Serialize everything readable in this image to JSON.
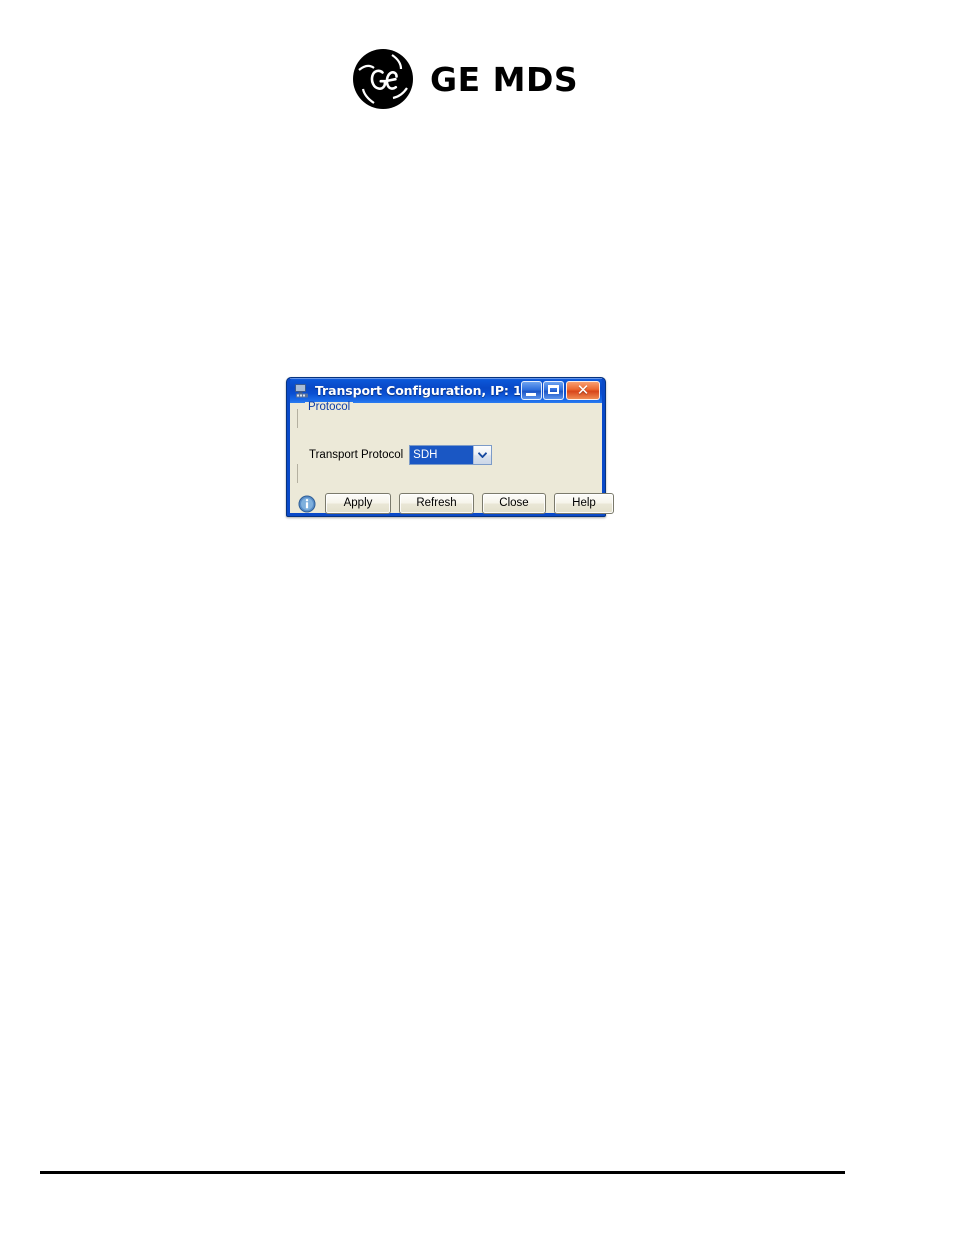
{
  "brand": {
    "logo_icon": "ge-monogram-icon",
    "wordmark": "GE MDS"
  },
  "dialog": {
    "title": "Transport Configuration, IP: 1...",
    "window_icon": "network-computer-icon",
    "colors": {
      "titlebar_blue": "#0a49c8",
      "client_beige": "#ece9d8",
      "selection_blue": "#1a57c4",
      "group_label_blue": "#0f3fa8",
      "close_orange": "#ec6a32"
    },
    "window_controls": [
      {
        "name": "minimize-button",
        "glyph": "minimize-icon",
        "label": "Minimize"
      },
      {
        "name": "maximize-button",
        "glyph": "maximize-icon",
        "label": "Maximize"
      },
      {
        "name": "close-button",
        "glyph": "close-icon",
        "label": "Close"
      }
    ],
    "group": {
      "legend": "Protocol",
      "field_label": "Transport Protocol",
      "combo": {
        "value": "SDH",
        "arrow_icon": "chevron-down-icon"
      }
    },
    "info_icon": "info-icon",
    "buttons": [
      {
        "id": "apply-button",
        "label": "Apply"
      },
      {
        "id": "refresh-button",
        "label": "Refresh"
      },
      {
        "id": "close-button",
        "label": "Close"
      },
      {
        "id": "help-button",
        "label": "Help"
      }
    ]
  }
}
